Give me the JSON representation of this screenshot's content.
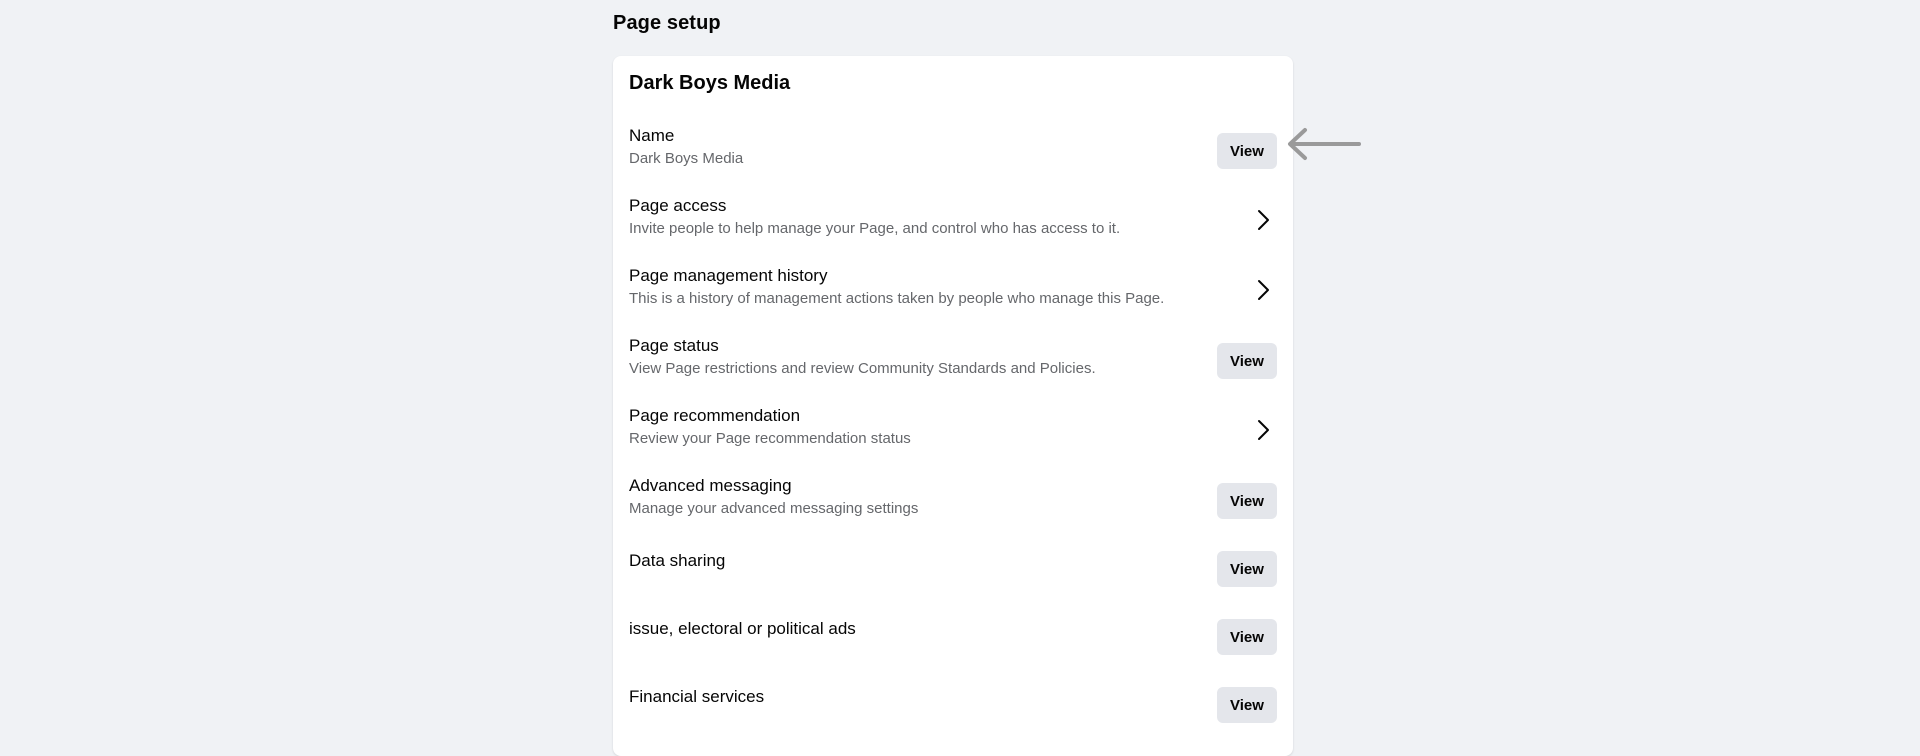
{
  "page": {
    "heading": "Page setup"
  },
  "card": {
    "title": "Dark Boys Media",
    "rows": [
      {
        "label": "Name",
        "description": "Dark Boys Media",
        "action": "view",
        "button_label": "View"
      },
      {
        "label": "Page access",
        "description": "Invite people to help manage your Page, and control who has access to it.",
        "action": "chevron"
      },
      {
        "label": "Page management history",
        "description": "This is a history of management actions taken by people who manage this Page.",
        "action": "chevron"
      },
      {
        "label": "Page status",
        "description": "View Page restrictions and review Community Standards and Policies.",
        "action": "view",
        "button_label": "View"
      },
      {
        "label": "Page recommendation",
        "description": "Review your Page recommendation status",
        "action": "chevron"
      },
      {
        "label": "Advanced messaging",
        "description": "Manage your advanced messaging settings",
        "action": "view",
        "button_label": "View"
      },
      {
        "label": "Data sharing",
        "description": "",
        "action": "view",
        "button_label": "View"
      },
      {
        "label": "issue, electoral or political ads",
        "description": "",
        "action": "view",
        "button_label": "View"
      },
      {
        "label": "Financial services",
        "description": "",
        "action": "view",
        "button_label": "View"
      }
    ]
  },
  "icons": {
    "chevron": "chevron-right-icon",
    "arrow": "arrow-left-icon"
  },
  "colors": {
    "background": "#f0f2f5",
    "card": "#ffffff",
    "button": "#e4e6eb",
    "secondary_text": "#65676b",
    "arrow": "#9a9a9a"
  }
}
